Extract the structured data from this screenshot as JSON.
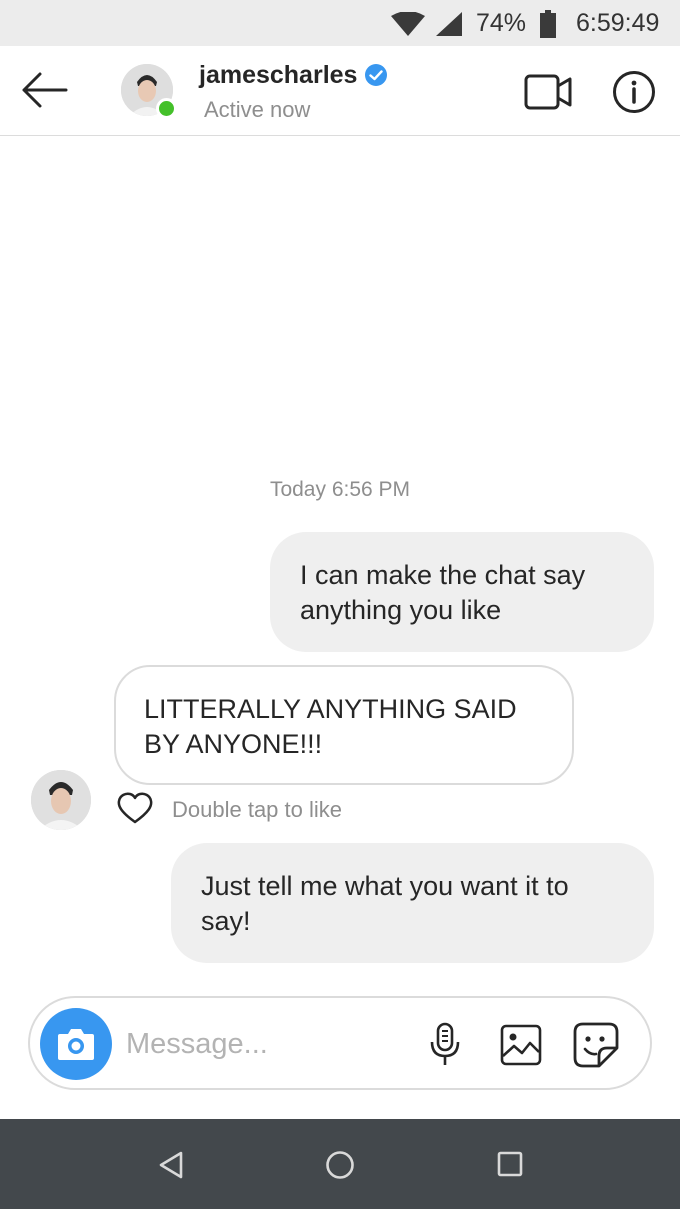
{
  "status_bar": {
    "battery_percent": "74%",
    "time": "6:59:49",
    "icons": [
      "wifi-icon",
      "signal-icon",
      "battery-icon"
    ]
  },
  "header": {
    "username": "jamescharles",
    "verified": true,
    "status": "Active now",
    "icons": [
      "back-arrow-icon",
      "verified-badge-icon",
      "video-call-icon",
      "info-icon"
    ]
  },
  "thread": {
    "timestamp": "Today 6:56 PM",
    "messages": [
      {
        "direction": "outgoing",
        "text": "I can make the chat say anything you like"
      },
      {
        "direction": "incoming",
        "text": "LITTERALLY ANYTHING SAID BY ANYONE!!!"
      },
      {
        "direction": "outgoing",
        "text": "Just tell me what you want it to say!"
      }
    ],
    "like_hint": "Double tap to like"
  },
  "composer": {
    "placeholder": "Message...",
    "value": "",
    "icons": [
      "camera-icon",
      "microphone-icon",
      "gallery-icon",
      "sticker-icon"
    ]
  },
  "nav_bar": {
    "icons": [
      "nav-back-icon",
      "nav-home-icon",
      "nav-recents-icon"
    ]
  },
  "colors": {
    "accent": "#3897f0",
    "online": "#44c02a",
    "outgoing_bubble": "#efefef",
    "nav_bar": "#43484c"
  }
}
